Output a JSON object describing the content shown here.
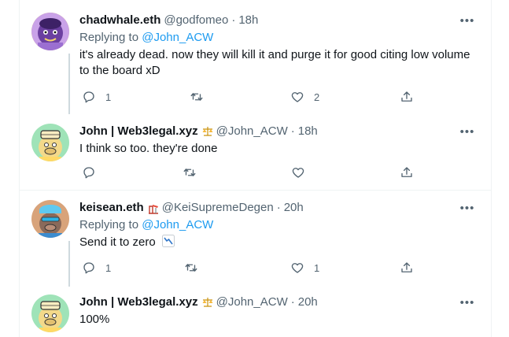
{
  "tweets": [
    {
      "name": "chadwhale.eth",
      "handle": "@godfomeo",
      "time": "18h",
      "replying_label": "Replying to ",
      "replying_to": "@John_ACW",
      "text_line1": "it's already dead. now they will kill it and purge it for good citing low volume",
      "text_line2": "to the board xD",
      "replies": "1",
      "retweets": "",
      "likes": "2",
      "avatar_icon": "purple-character-avatar"
    },
    {
      "name": "John | Web3legal.xyz",
      "badge_icon": "balance-scale-icon",
      "handle": "@John_ACW",
      "time": "18h",
      "text_line1": "I think so too.  they're done",
      "replies": "",
      "retweets": "",
      "likes": "",
      "avatar_icon": "cartoon-ape-avatar"
    },
    {
      "name": "keisean.eth",
      "badge_icon": "oil-pump-icon",
      "handle": "@KeiSupremeDegen",
      "time": "20h",
      "replying_label": "Replying to ",
      "replying_to": "@John_ACW",
      "text_line1": "Send it to zero",
      "text_emoji": "chart-decreasing-icon",
      "replies": "1",
      "retweets": "",
      "likes": "1",
      "avatar_icon": "cartoon-ape-avatar"
    },
    {
      "name": "John | Web3legal.xyz",
      "badge_icon": "balance-scale-icon",
      "handle": "@John_ACW",
      "time": "20h",
      "text_line1": "100%",
      "avatar_icon": "cartoon-ape-avatar"
    }
  ],
  "more_label": "•••",
  "dot": "·",
  "colors": {
    "link": "#1d9bf0",
    "secondary": "#536471",
    "border": "#eff3f4",
    "thread": "#cfd9de"
  }
}
